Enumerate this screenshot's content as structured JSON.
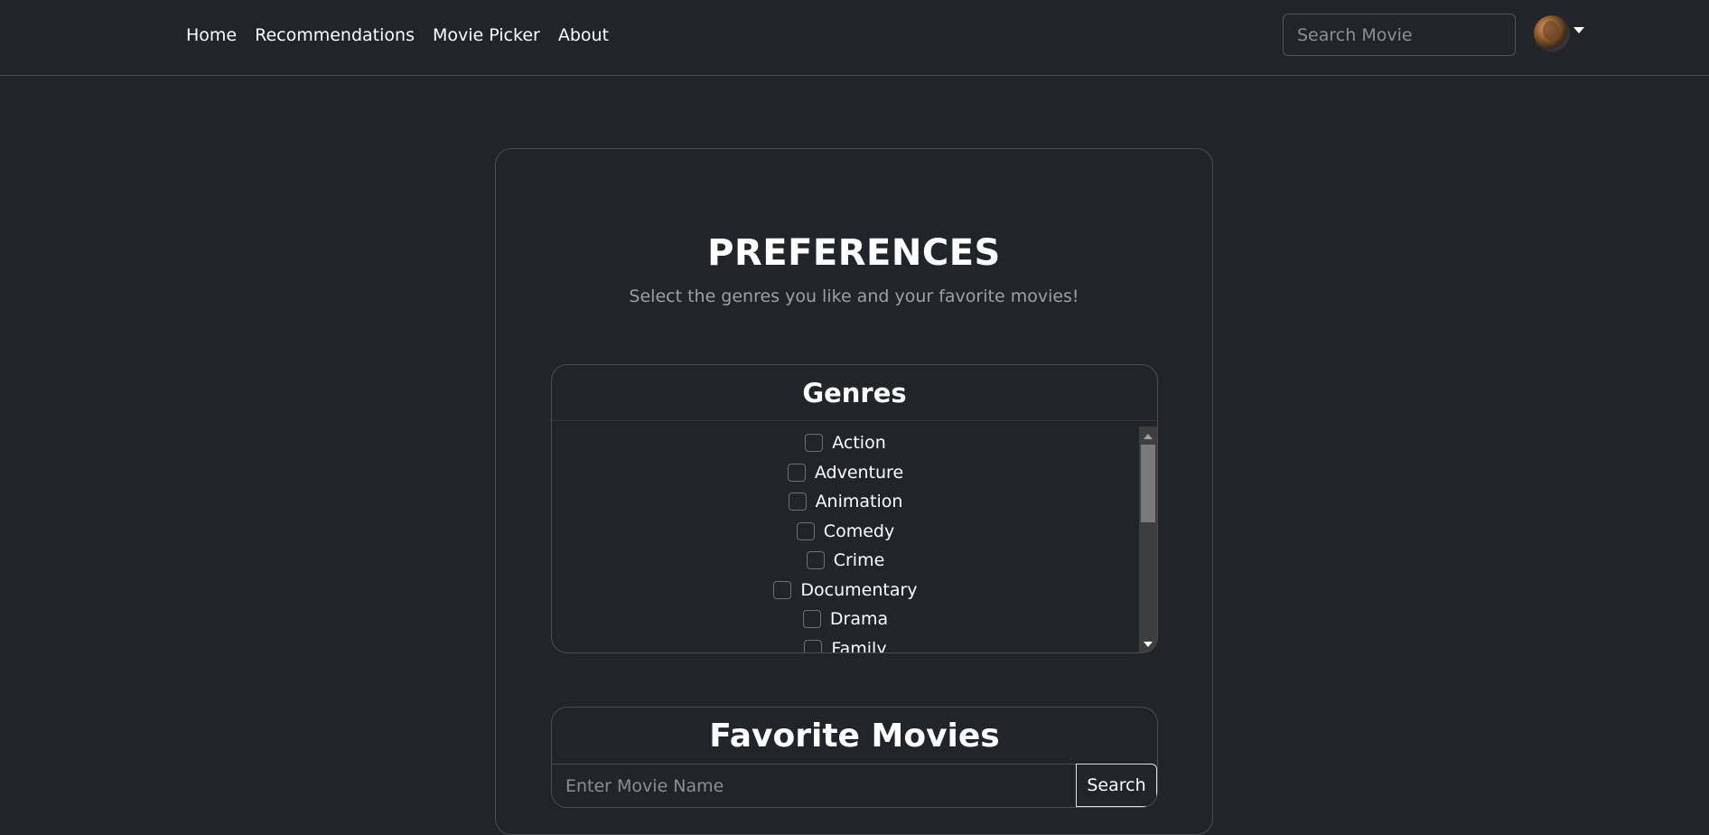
{
  "nav": {
    "links": [
      "Home",
      "Recommendations",
      "Movie Picker",
      "About"
    ],
    "search_placeholder": "Search Movie"
  },
  "preferences": {
    "title": "PREFERENCES",
    "subtitle": "Select the genres you like and your favorite movies!"
  },
  "genres": {
    "header": "Genres",
    "items": [
      "Action",
      "Adventure",
      "Animation",
      "Comedy",
      "Crime",
      "Documentary",
      "Drama",
      "Family"
    ]
  },
  "favorites": {
    "header": "Favorite Movies",
    "input_placeholder": "Enter Movie Name",
    "search_label": "Search"
  }
}
